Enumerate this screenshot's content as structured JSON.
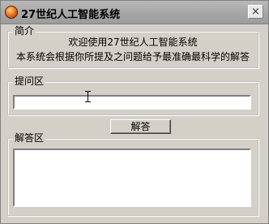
{
  "window": {
    "title": "27世纪人工智能系统",
    "close_label": "×"
  },
  "intro": {
    "legend": "简介",
    "line1": "欢迎使用27世纪人工智能系统",
    "line2": "本系统会根据你所提及之问题给予最准确最科学的解答"
  },
  "question": {
    "legend": "提问区",
    "value": ""
  },
  "answer_button_label": "解答",
  "answer": {
    "legend": "解答区",
    "value": ""
  }
}
